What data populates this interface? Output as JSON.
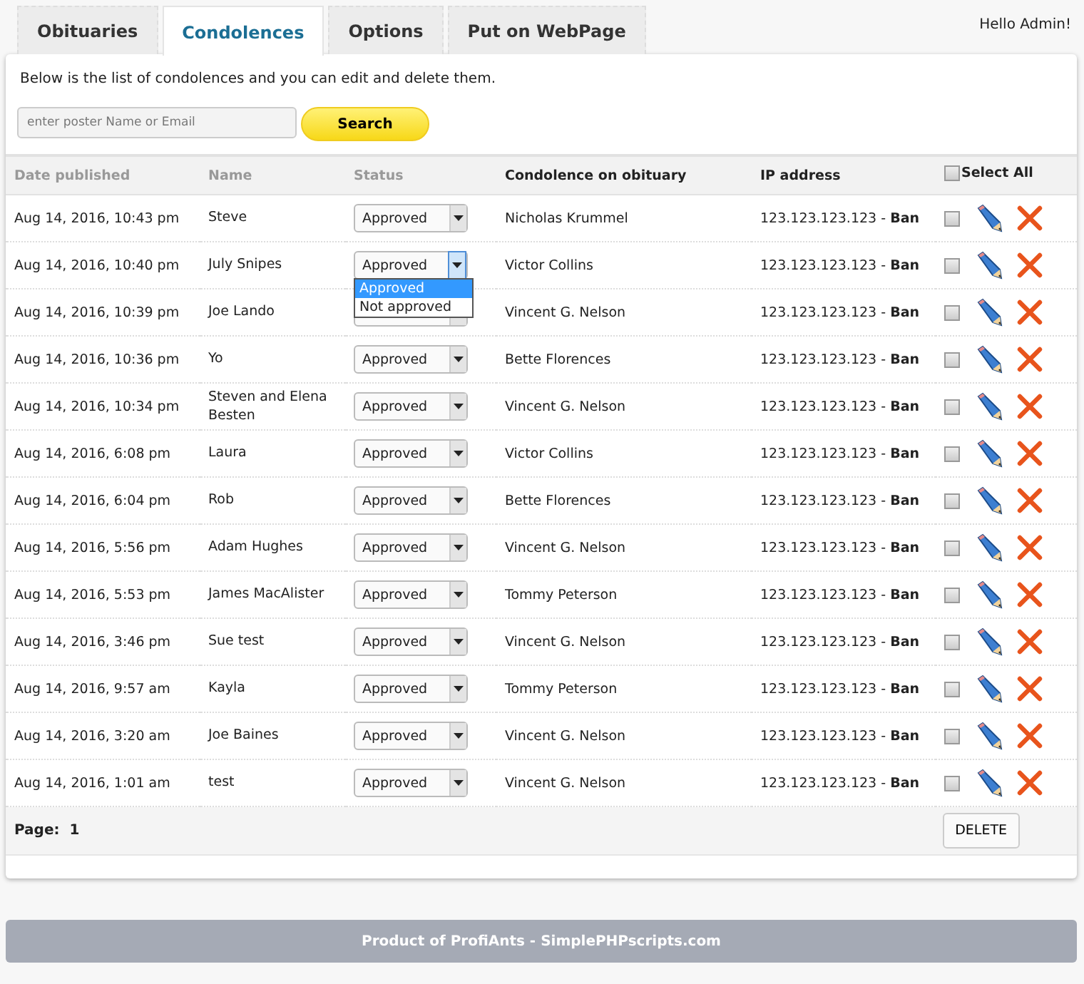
{
  "tabs": [
    {
      "label": "Obituaries",
      "selected": false
    },
    {
      "label": "Condolences",
      "selected": true
    },
    {
      "label": "Options",
      "selected": false
    },
    {
      "label": "Put on WebPage",
      "selected": false
    }
  ],
  "greeting": "Hello Admin!",
  "intro": "Below is the list of condolences and you can edit and delete them.",
  "search": {
    "placeholder": "enter poster Name or Email",
    "button": "Search"
  },
  "table": {
    "columns": [
      "Date published",
      "Name",
      "Status",
      "Condolence on obituary",
      "IP address"
    ],
    "separator": "-",
    "select_all": {
      "label": "Select All",
      "checked": false
    },
    "status_menu": [
      {
        "label": "Approved",
        "selected": true
      },
      {
        "label": "Not approved",
        "selected": false
      }
    ],
    "rows": [
      {
        "date": "Aug 14, 2016, 10:43 pm",
        "name": "Steve",
        "status": "Approved",
        "open": false,
        "obituary": "Nicholas Krummel",
        "ip": "123.123.123.123",
        "ban": "Ban",
        "checked": false
      },
      {
        "date": "Aug 14, 2016, 10:40 pm",
        "name": "July Snipes",
        "status": "Approved",
        "open": true,
        "obituary": "Victor Collins",
        "ip": "123.123.123.123",
        "ban": "Ban",
        "checked": false
      },
      {
        "date": "Aug 14, 2016, 10:39 pm",
        "name": "Joe Lando",
        "open": false,
        "obituary": "Vincent G. Nelson",
        "ip": "123.123.123.123",
        "ban": "Ban",
        "checked": false
      },
      {
        "date": "Aug 14, 2016, 10:36 pm",
        "name": "Yo",
        "status": "Approved",
        "open": false,
        "obituary": "Bette Florences",
        "ip": "123.123.123.123",
        "ban": "Ban",
        "checked": false
      },
      {
        "date": "Aug 14, 2016, 10:34 pm",
        "name": "Steven and Elena Besten",
        "status": "Approved",
        "open": false,
        "obituary": "Vincent G. Nelson",
        "ip": "123.123.123.123",
        "ban": "Ban",
        "checked": false
      },
      {
        "date": "Aug 14, 2016, 6:08 pm",
        "name": "Laura",
        "status": "Approved",
        "open": false,
        "obituary": "Victor Collins",
        "ip": "123.123.123.123",
        "ban": "Ban",
        "checked": false
      },
      {
        "date": "Aug 14, 2016, 6:04 pm",
        "name": "Rob",
        "status": "Approved",
        "open": false,
        "obituary": "Bette Florences",
        "ip": "123.123.123.123",
        "ban": "Ban",
        "checked": false
      },
      {
        "date": "Aug 14, 2016, 5:56 pm",
        "name": "Adam Hughes",
        "status": "Approved",
        "open": false,
        "obituary": "Vincent G. Nelson",
        "ip": "123.123.123.123",
        "ban": "Ban",
        "checked": false
      },
      {
        "date": "Aug 14, 2016, 5:53 pm",
        "name": "James MacAlister",
        "status": "Approved",
        "open": false,
        "obituary": "Tommy Peterson",
        "ip": "123.123.123.123",
        "ban": "Ban",
        "checked": false
      },
      {
        "date": "Aug 14, 2016, 3:46 pm",
        "name": "Sue test",
        "status": "Approved",
        "open": false,
        "obituary": "Vincent G. Nelson",
        "ip": "123.123.123.123",
        "ban": "Ban",
        "checked": false
      },
      {
        "date": "Aug 14, 2016, 9:57 am",
        "name": "Kayla",
        "status": "Approved",
        "open": false,
        "obituary": "Tommy Peterson",
        "ip": "123.123.123.123",
        "ban": "Ban",
        "checked": false
      },
      {
        "date": "Aug 14, 2016, 3:20 am",
        "name": "Joe Baines",
        "status": "Approved",
        "open": false,
        "obituary": "Vincent G. Nelson",
        "ip": "123.123.123.123",
        "ban": "Ban",
        "checked": false
      },
      {
        "date": "Aug 14, 2016, 1:01 am",
        "name": "test",
        "status": "Approved",
        "open": false,
        "obituary": "Vincent G. Nelson",
        "ip": "123.123.123.123",
        "ban": "Ban",
        "checked": false
      }
    ]
  },
  "pager": {
    "label": "Page:",
    "page": "1",
    "delete": "DELETE"
  },
  "footer": "Product of ProfiAnts - SimplePHPscripts.com"
}
